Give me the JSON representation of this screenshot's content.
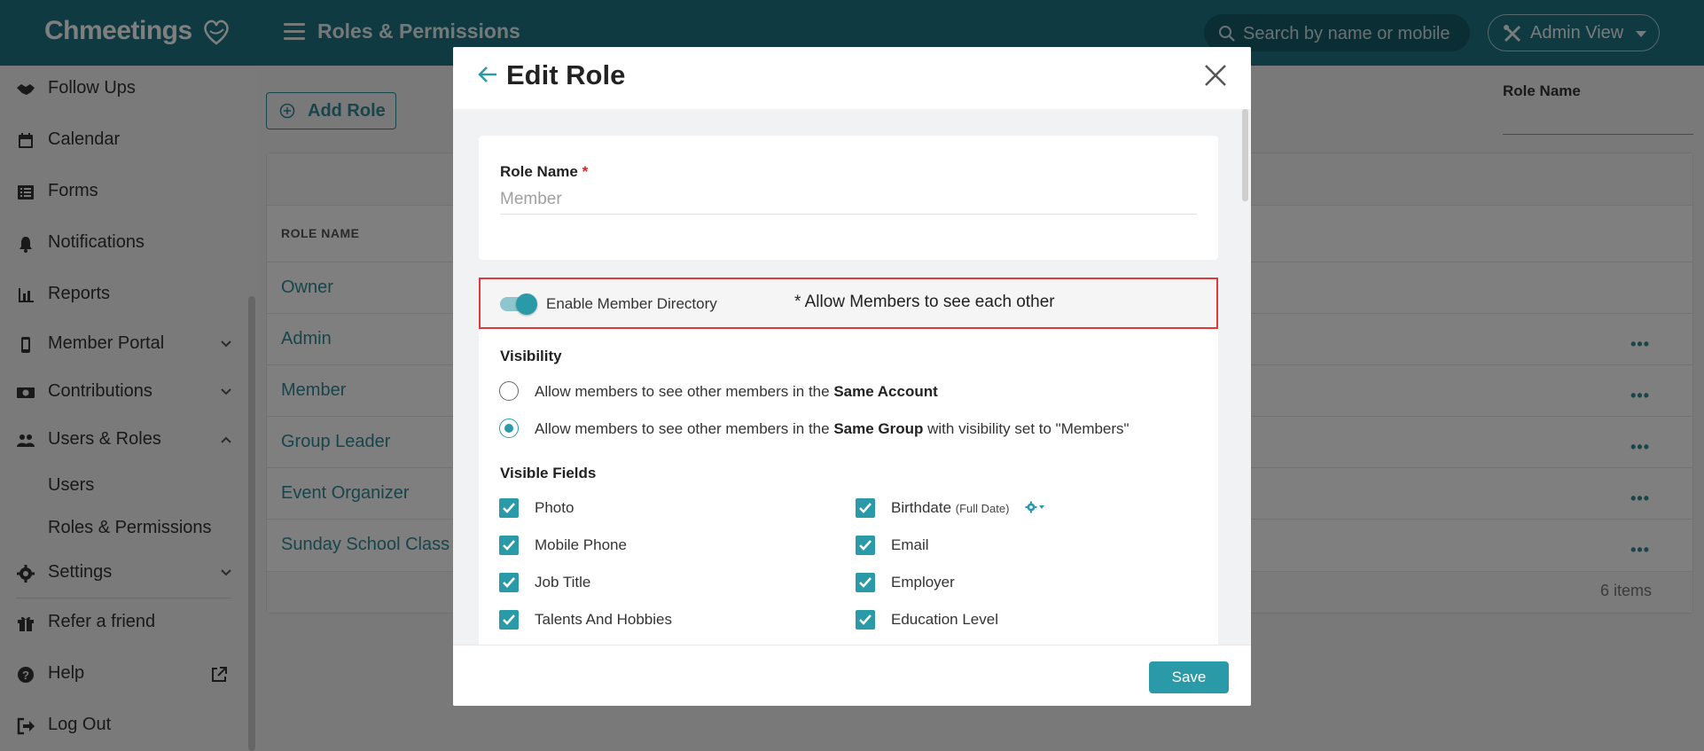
{
  "header": {
    "logo": "Chmeetings",
    "page_title": "Roles & Permissions",
    "search_placeholder": "Search by name or mobile",
    "admin_view": "Admin View"
  },
  "sidebar": {
    "items": [
      {
        "label": "Follow Ups",
        "icon": "handshake-icon"
      },
      {
        "label": "Calendar",
        "icon": "calendar-icon"
      },
      {
        "label": "Forms",
        "icon": "list-icon"
      },
      {
        "label": "Notifications",
        "icon": "bell-icon"
      },
      {
        "label": "Reports",
        "icon": "bar-chart-icon"
      },
      {
        "label": "Member Portal",
        "icon": "mobile-icon"
      },
      {
        "label": "Contributions",
        "icon": "money-icon"
      },
      {
        "label": "Users & Roles",
        "icon": "users-icon"
      },
      {
        "label": "Settings",
        "icon": "gear-icon"
      },
      {
        "label": "Refer a friend",
        "icon": "gift-icon"
      },
      {
        "label": "Help",
        "icon": "question-icon"
      },
      {
        "label": "Log Out",
        "icon": "logout-icon"
      }
    ],
    "sub_items": [
      "Users",
      "Roles & Permissions"
    ]
  },
  "main": {
    "add_role": "Add Role",
    "filter_label": "Role Name",
    "column_header": "ROLE NAME",
    "rows": [
      "Owner",
      "Admin",
      "Member",
      "Group Leader",
      "Event Organizer",
      "Sunday School Class"
    ],
    "items_count": "6 items"
  },
  "modal": {
    "title": "Edit Role",
    "role_name_label": "Role Name",
    "required_mark": "*",
    "role_name_placeholder": "Member",
    "enable_directory_label": "Enable Member Directory",
    "directory_note": "* Allow Members to see each other",
    "visibility_title": "Visibility",
    "visibility_options": [
      {
        "pre": "Allow members to see other members in the ",
        "bold": "Same Account",
        "post": "",
        "selected": false
      },
      {
        "pre": "Allow members to see other members in the ",
        "bold": "Same Group",
        "post": " with visibility set to \"Members\"",
        "selected": true
      }
    ],
    "visible_fields_title": "Visible Fields",
    "fields_left": [
      "Photo",
      "Mobile Phone",
      "Job Title",
      "Talents And Hobbies"
    ],
    "fields_right": [
      "Birthdate",
      "Email",
      "Employer",
      "Education Level"
    ],
    "birthdate_note": "(Full Date)",
    "save": "Save"
  },
  "colors": {
    "brand": "#1f7582",
    "accent": "#2b9aa8",
    "highlight_border": "#e0393b"
  }
}
